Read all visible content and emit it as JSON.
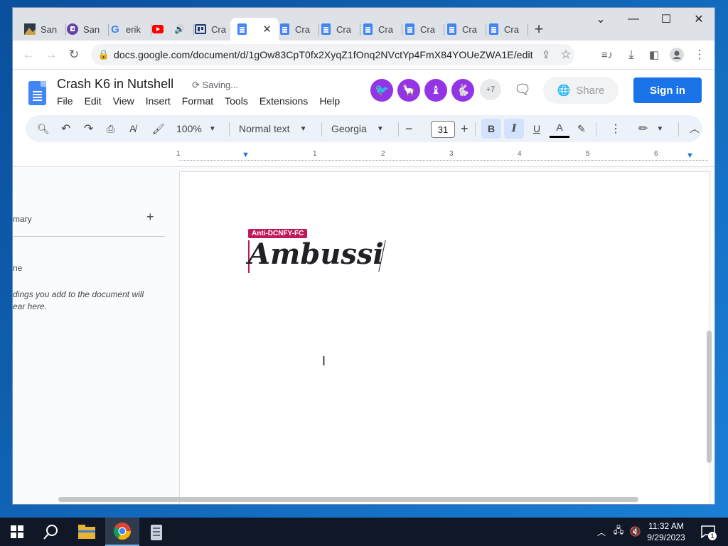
{
  "browser": {
    "tabs": [
      {
        "title": "San",
        "icon": "landscape-icon"
      },
      {
        "title": "San",
        "icon": "twitch-icon"
      },
      {
        "title": "erik",
        "icon": "google-icon"
      },
      {
        "title": "",
        "icon": "youtube-icon"
      },
      {
        "title": "Cra",
        "icon": "board-icon"
      },
      {
        "title": "",
        "icon": "docs-icon",
        "active": true
      },
      {
        "title": "Cra",
        "icon": "docs-icon"
      },
      {
        "title": "Cra",
        "icon": "docs-icon"
      },
      {
        "title": "Cra",
        "icon": "docs-icon"
      },
      {
        "title": "Cra",
        "icon": "docs-icon"
      },
      {
        "title": "Cra",
        "icon": "docs-icon"
      },
      {
        "title": "Cra",
        "icon": "docs-icon"
      }
    ],
    "url": "docs.google.com/document/d/1gOw83CpT0fx2XyqZ1fOnq2NVctYp4FmX84YOUeZWA1E/edit",
    "new_tab_symbol": "+"
  },
  "docs": {
    "title": "Crash K6 in Nutshell",
    "status": "Saving...",
    "menu": [
      "File",
      "Edit",
      "View",
      "Insert",
      "Format",
      "Tools",
      "Extensions",
      "Help"
    ],
    "collaborators_more": "+7",
    "share_label": "Share",
    "signin_label": "Sign in"
  },
  "format_toolbar": {
    "zoom": "100%",
    "style": "Normal text",
    "font": "Georgia",
    "font_size": "31",
    "bold": "B",
    "italic": "I",
    "underline": "U",
    "text_color": "A"
  },
  "ruler": {
    "marks": [
      "1",
      "1",
      "2",
      "3",
      "4",
      "5",
      "6"
    ]
  },
  "outline": {
    "summary_label": "mary",
    "headings_label": "ne",
    "hint_line1": "dings you add to the document will",
    "hint_line2": "ear here."
  },
  "document": {
    "collaborator_name": "Anti-DCNFY-FC",
    "body_text": "Ambussi"
  },
  "taskbar": {
    "time": "11:32 AM",
    "date": "9/29/2023",
    "notification_count": "1"
  },
  "colors": {
    "accent": "#1a73e8",
    "collaborator": "#c2185b",
    "avatar_purple": "#9334e6"
  }
}
